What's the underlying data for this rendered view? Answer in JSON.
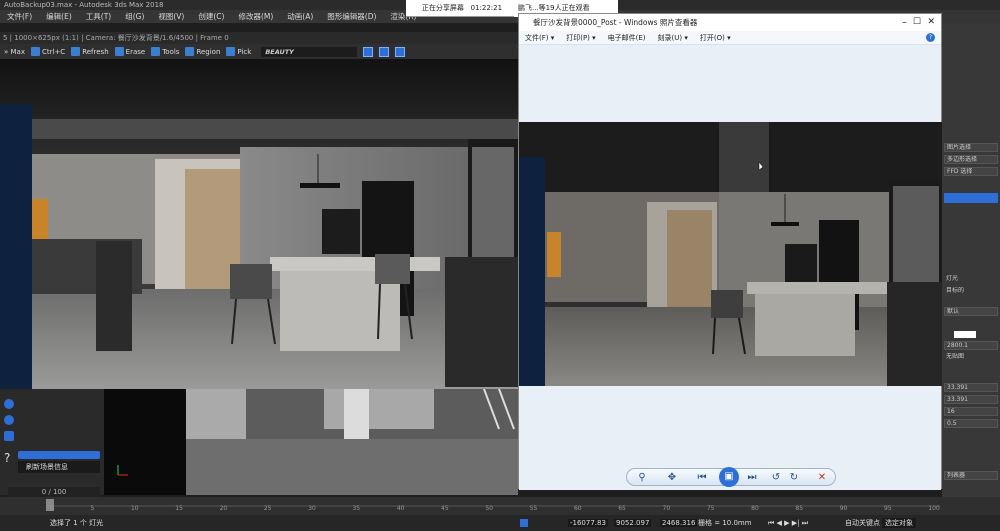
{
  "max": {
    "title": "AutoBackup03.max - Autodesk 3ds Max 2018",
    "menu": [
      "文件(F)",
      "编辑(E)",
      "工具(T)",
      "组(G)",
      "视图(V)",
      "创建(C)",
      "修改器(M)",
      "动画(A)",
      "图形编辑器(D)",
      "渲染(R)"
    ],
    "vfb_info": "5 | 1000×625px (1:1) | Camera: 餐厅沙发背景/1.6/4500 | Frame 0",
    "toolbar": [
      "» Max",
      "Ctrl+C",
      "Refresh",
      "Erase",
      "Tools",
      "Region",
      "Pick"
    ],
    "channel": "BEAUTY",
    "scene_info_label": "刷新场景信息",
    "frame_counter": "0 / 100",
    "status_text": "选择了 1 个 灯光",
    "coords": [
      "-16077.83",
      "9052.097",
      "2468.316"
    ],
    "grid": "栅格 = 10.0mm",
    "auto_key": "自动关键点",
    "selected": "选定对象",
    "timeline_ticks": [
      "0",
      "5",
      "10",
      "15",
      "20",
      "25",
      "30",
      "35",
      "40",
      "45",
      "50",
      "55",
      "60",
      "65",
      "70",
      "75",
      "80",
      "85",
      "90",
      "95",
      "100"
    ]
  },
  "share": {
    "status": "正在分享屏幕",
    "timer": "01:22:21",
    "viewers": "鹏飞...等19人正在观看"
  },
  "viewer": {
    "title": "餐厅沙发背景0000_Post - Windows 照片查看器",
    "menu": [
      "文件(F) ▾",
      "打印(P) ▾",
      "电子邮件(E)",
      "刻录(U) ▾",
      "打开(O) ▾"
    ],
    "help": "?"
  },
  "right_panel": {
    "rows": [
      "图片选择",
      "多边形选择",
      "FFD 选择",
      "灯光",
      "目标的",
      "默认",
      "2800.1",
      "无贴图",
      "33.391",
      "33.391",
      "16",
      "0.5",
      "列表器"
    ]
  },
  "colors": {
    "accent": "#2d6fd6",
    "viewer_bg": "#e8eff7"
  }
}
